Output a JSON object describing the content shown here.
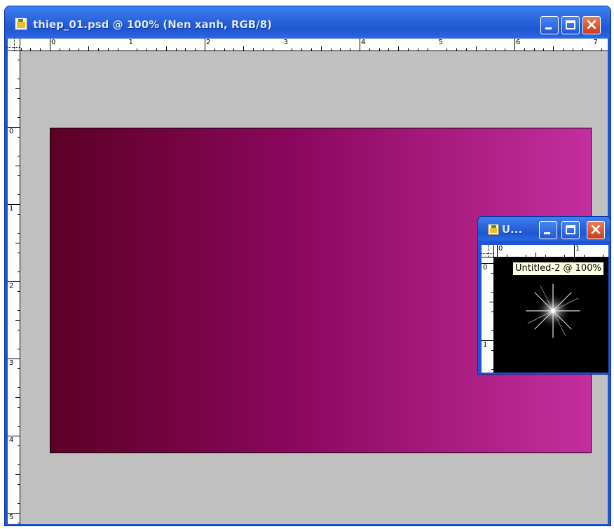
{
  "main_window": {
    "title": "thiep_01.psd @ 100% (Nen xanh, RGB/8)",
    "h_ruler_labels": [
      "0",
      "1",
      "2",
      "3",
      "4",
      "5",
      "6",
      "7"
    ],
    "v_ruler_labels": [
      "0",
      "1",
      "2",
      "3",
      "4",
      "5"
    ],
    "gradient": {
      "start_color": "#5c0025",
      "end_color": "#c32f9e"
    }
  },
  "small_window": {
    "title": "U...",
    "h_ruler_labels": [
      "0",
      "1"
    ],
    "v_ruler_labels": [
      "0",
      "1"
    ]
  },
  "tooltip": {
    "text": "Untitled-2 @ 100%"
  },
  "colors": {
    "title_bar": "#2b63da",
    "workspace": "#c0c0c0",
    "close_button": "#d9482b"
  },
  "icons": [
    "document-icon",
    "minimize-icon",
    "maximize-icon",
    "close-icon",
    "sparkle-icon"
  ]
}
